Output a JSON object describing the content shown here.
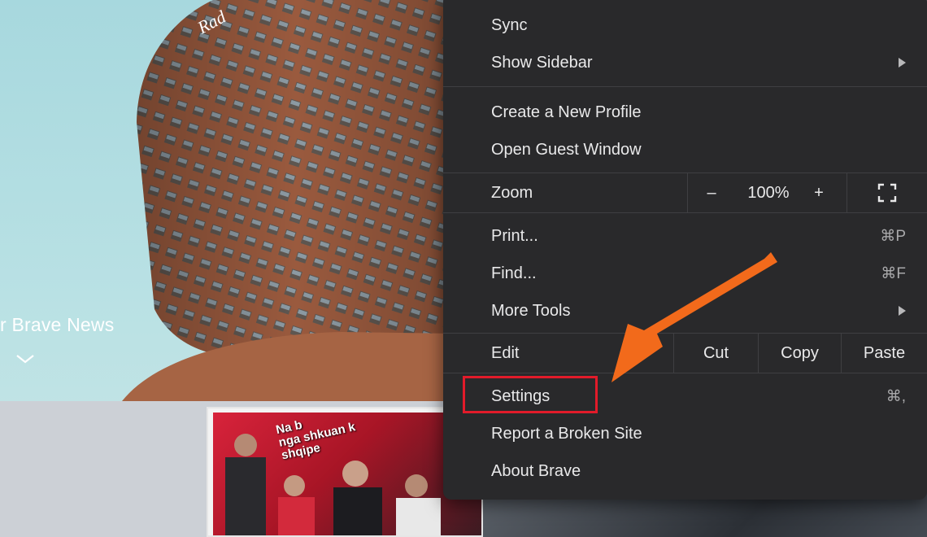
{
  "background": {
    "news_caption": "r Brave News",
    "thumbnail_caption": [
      "Na b",
      "nga shkuan k",
      "shqipe"
    ]
  },
  "menu": {
    "sync": "Sync",
    "show_sidebar": "Show Sidebar",
    "create_profile": "Create a New Profile",
    "guest_window": "Open Guest Window",
    "zoom": {
      "label": "Zoom",
      "minus": "–",
      "value": "100%",
      "plus": "+"
    },
    "print": {
      "label": "Print...",
      "shortcut": "⌘P"
    },
    "find": {
      "label": "Find...",
      "shortcut": "⌘F"
    },
    "more_tools": "More Tools",
    "edit": {
      "label": "Edit",
      "cut": "Cut",
      "copy": "Copy",
      "paste": "Paste"
    },
    "settings": {
      "label": "Settings",
      "shortcut": "⌘,"
    },
    "report_site": "Report a Broken Site",
    "about": "About Brave"
  },
  "colors": {
    "menu_bg": "#29292b",
    "highlight_box": "#e21b2a",
    "annotation_arrow": "#f26a1b"
  }
}
